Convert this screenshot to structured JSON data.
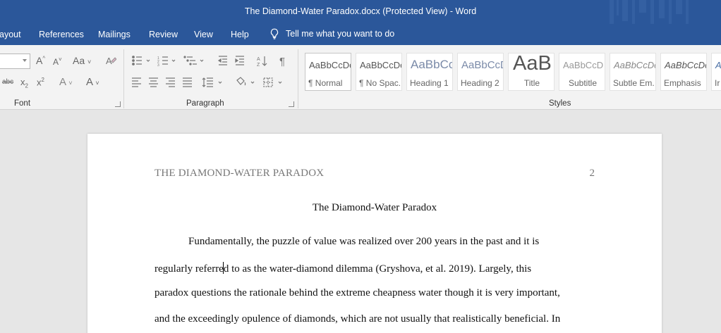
{
  "window": {
    "title": "The Diamond-Water Paradox.docx (Protected View)  -  Word"
  },
  "menu": {
    "tabs": [
      "ayout",
      "References",
      "Mailings",
      "Review",
      "View",
      "Help"
    ],
    "tell_me": "Tell me what you want to do"
  },
  "ribbon": {
    "groups": {
      "font": "Font",
      "paragraph": "Paragraph",
      "styles": "Styles"
    },
    "font_row1": {
      "grow": "A",
      "shrink": "A",
      "change_case": "Aa"
    },
    "font_row2": {
      "strike": "abc",
      "sub": "x",
      "sub_mark": "2",
      "sup": "x",
      "sup_mark": "2",
      "effects": "A",
      "color": "A"
    },
    "styles": [
      {
        "sample": "AaBbCcDc",
        "name": "¶ Normal"
      },
      {
        "sample": "AaBbCcDc",
        "name": "¶ No Spac..."
      },
      {
        "sample": "AaBbCc",
        "name": "Heading 1"
      },
      {
        "sample": "AaBbCcD",
        "name": "Heading 2"
      },
      {
        "sample": "AaB",
        "name": "Title"
      },
      {
        "sample": "AaBbCcD",
        "name": "Subtitle"
      },
      {
        "sample": "AaBbCcDc",
        "name": "Subtle Em..."
      },
      {
        "sample": "AaBbCcDc",
        "name": "Emphasis"
      },
      {
        "sample": "Aa",
        "name": "Ir"
      }
    ]
  },
  "document": {
    "running_head": "THE DIAMOND-WATER PARADOX",
    "page_number": "2",
    "title": "The Diamond-Water Paradox",
    "line1": "Fundamentally, the puzzle of value was realized over 200 years in the past and it is",
    "line2_before_caret": "regularly referre",
    "line2_after_caret": "d to as the water-diamond dilemma (Gryshova, et al. 2019). Largely, this",
    "line3": "paradox questions the rationale behind the extreme cheapness water though it is very important,",
    "line4": "and the exceedingly opulence of diamonds, which are not usually that realistically beneficial. In"
  },
  "colors": {
    "titlebar": "#2b579a",
    "ribbon": "#f3f3f3",
    "canvas": "#e6e6e6"
  }
}
